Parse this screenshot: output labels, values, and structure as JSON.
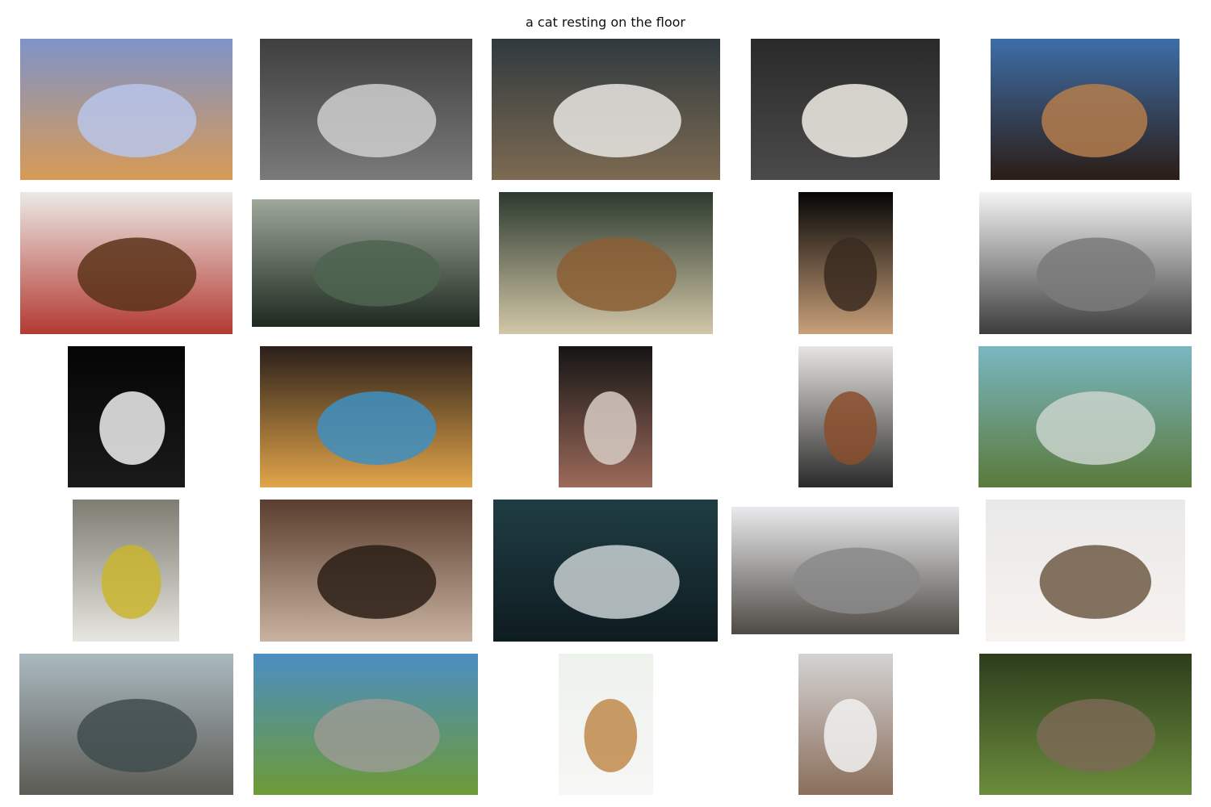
{
  "query": "a cat resting on the floor",
  "images": [
    {
      "name": "ginger-cat-under-blue-blanket-image",
      "colors": [
        "#7f93c9",
        "#b9c6ea",
        "#d89a55"
      ]
    },
    {
      "name": "woman-holding-cat-bw-image",
      "colors": [
        "#3f3f3f",
        "#cfcfcf",
        "#7a7a7a"
      ]
    },
    {
      "name": "tabby-cat-face-closeup-image",
      "colors": [
        "#2f3a3e",
        "#e9e6e3",
        "#7d6a52"
      ]
    },
    {
      "name": "french-bulldog-sleeping-image",
      "colors": [
        "#2a2a2a",
        "#f1ede6",
        "#4a4a4a"
      ]
    },
    {
      "name": "red-rock-mountain-blue-sky-image",
      "colors": [
        "#3d6ea8",
        "#b47c4c",
        "#2c1d16"
      ]
    },
    {
      "name": "dog-by-fireplace-with-flag-image",
      "colors": [
        "#eceae6",
        "#5a3219",
        "#b33a32"
      ]
    },
    {
      "name": "person-on-misty-mountain-image",
      "colors": [
        "#9ea79a",
        "#4e6450",
        "#1e2a20"
      ]
    },
    {
      "name": "wooden-table-sunlit-room-image",
      "colors": [
        "#2c3a2e",
        "#8b5e32",
        "#d2c7a8"
      ]
    },
    {
      "name": "silhouette-dancer-dark-image",
      "colors": [
        "#050505",
        "#3a2a20",
        "#c9a07a"
      ]
    },
    {
      "name": "golden-gate-bridge-fog-image",
      "colors": [
        "#f4f4f4",
        "#7a7a7a",
        "#3c3c3c"
      ]
    },
    {
      "name": "dog-profile-bw-image",
      "colors": [
        "#050505",
        "#f0f0f0",
        "#1a1a1a"
      ]
    },
    {
      "name": "church-stained-glass-image",
      "colors": [
        "#2a1f1a",
        "#3e8fc2",
        "#e2a54a"
      ]
    },
    {
      "name": "woman-at-table-through-doorway-image",
      "colors": [
        "#151515",
        "#d7cdc4",
        "#9d6a5b"
      ]
    },
    {
      "name": "living-room-fireplace-image",
      "colors": [
        "#e7e5e1",
        "#8a4e2b",
        "#2a2a2a"
      ]
    },
    {
      "name": "sea-cliff-lighthouse-image",
      "colors": [
        "#7ab7c2",
        "#c9d3cc",
        "#5a7a3b"
      ]
    },
    {
      "name": "cat-on-yellow-bench-image",
      "colors": [
        "#7d7d72",
        "#c9b52e",
        "#e8e6e0"
      ]
    },
    {
      "name": "wooden-star-on-planks-image",
      "colors": [
        "#5a3d2e",
        "#2c1e16",
        "#c9b3a0"
      ]
    },
    {
      "name": "dark-mountains-teal-sky-image",
      "colors": [
        "#1f3d44",
        "#c9d1d3",
        "#0e1c20"
      ]
    },
    {
      "name": "grey-tabby-cat-profile-image",
      "colors": [
        "#e9eaec",
        "#8a8a8a",
        "#4e4a45"
      ]
    },
    {
      "name": "sleeping-kitten-white-blanket-image",
      "colors": [
        "#e9e9e9",
        "#6e5a45",
        "#f7f2ee"
      ]
    },
    {
      "name": "sea-stacks-coast-image",
      "colors": [
        "#aab9c0",
        "#3f4c4d",
        "#5c5b54"
      ]
    },
    {
      "name": "green-ridge-mountains-image",
      "colors": [
        "#4c8ec4",
        "#9a9a93",
        "#6c9a35"
      ]
    },
    {
      "name": "bengal-cat-on-white-bed-image",
      "colors": [
        "#edf1ec",
        "#c08a4a",
        "#f7f7f5"
      ]
    },
    {
      "name": "poodle-on-white-bed-image",
      "colors": [
        "#d4d4d4",
        "#f1f1f1",
        "#8a6e5a"
      ]
    },
    {
      "name": "french-bulldog-in-forest-image",
      "colors": [
        "#2d3d1c",
        "#7a6a55",
        "#6b8c3c"
      ]
    }
  ]
}
